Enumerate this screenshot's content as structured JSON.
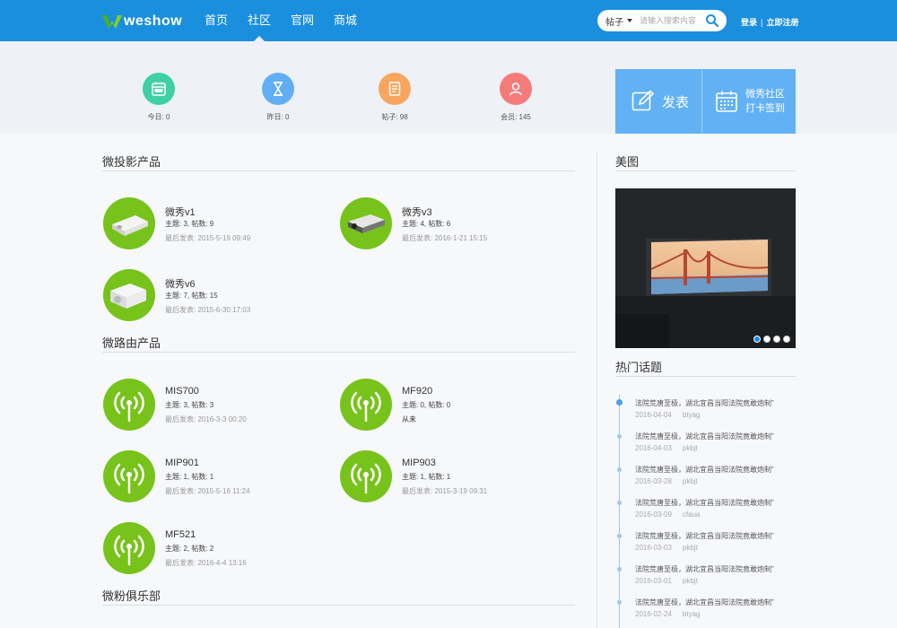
{
  "header": {
    "logo_text": "weshow",
    "nav": [
      "首页",
      "社区",
      "官网",
      "商城"
    ],
    "active_nav": 1,
    "search": {
      "type": "帖子",
      "placeholder": "请输入搜索内容"
    },
    "login": "登录",
    "register": "立即注册",
    "separator": "|"
  },
  "stats": [
    {
      "label": "今日: 0",
      "color": "#3fd0a5",
      "icon": "calendar-new-icon"
    },
    {
      "label": "昨日: 0",
      "color": "#62aef5",
      "icon": "hourglass-icon"
    },
    {
      "label": "帖子: 98",
      "color": "#f7a55f",
      "icon": "document-icon"
    },
    {
      "label": "会员: 145",
      "color": "#f57b7b",
      "icon": "user-icon"
    }
  ],
  "actions": {
    "post": "发表",
    "signin_line1": "微秀社区",
    "signin_line2": "打卡签到"
  },
  "sections": [
    {
      "title": "微投影产品",
      "forums": [
        {
          "name": "微秀v1",
          "count": "主题: 3, 帖数: 9",
          "last": "最后发表: 2015-5-19 09:49",
          "icon": "projector-icon"
        },
        {
          "name": "微秀v3",
          "count": "主题: 4, 帖数: 6",
          "last": "最后发表: 2016-1-21 15:15",
          "icon": "projector-icon"
        },
        {
          "name": "微秀v6",
          "count": "主题: 7, 帖数: 15",
          "last": "最后发表: 2015-6-30 17:03",
          "icon": "projector-icon"
        }
      ]
    },
    {
      "title": "微路由产品",
      "forums": [
        {
          "name": "MIS700",
          "count": "主题: 3, 帖数: 3",
          "last": "最后发表: 2016-3-3 00:20",
          "icon": "antenna-icon"
        },
        {
          "name": "MF920",
          "count": "主题: 0, 帖数: 0",
          "last": "从未",
          "icon": "antenna-icon"
        },
        {
          "name": "MIP901",
          "count": "主题: 1, 帖数: 1",
          "last": "最后发表: 2015-5-16 11:24",
          "icon": "antenna-icon"
        },
        {
          "name": "MIP903",
          "count": "主题: 1, 帖数: 1",
          "last": "最后发表: 2015-3-19 09:31",
          "icon": "antenna-icon"
        },
        {
          "name": "MF521",
          "count": "主题: 2, 帖数: 2",
          "last": "最后发表: 2016-4-4 13:16",
          "icon": "antenna-icon"
        }
      ]
    },
    {
      "title": "微粉俱乐部",
      "forums": []
    }
  ],
  "sidebar": {
    "gallery_title": "美图",
    "carousel_count": 4,
    "carousel_active": 0,
    "hot_title": "热门话题",
    "topics": [
      {
        "title": "法院荒唐至极，湖北宜昌当阳法院竟敢炮制”",
        "date": "2016-04-04",
        "user": "btyag"
      },
      {
        "title": "法院荒唐至极，湖北宜昌当阳法院竟敢炮制”",
        "date": "2016-04-03",
        "user": "pkbjt"
      },
      {
        "title": "法院荒唐至极，湖北宜昌当阳法院竟敢炮制”",
        "date": "2016-03-28",
        "user": "pkbjt"
      },
      {
        "title": "法院荒唐至极，湖北宜昌当阳法院竟敢炮制”",
        "date": "2016-03-09",
        "user": "cfaua"
      },
      {
        "title": "法院荒唐至极，湖北宜昌当阳法院竟敢炮制”",
        "date": "2016-03-03",
        "user": "pkbjt"
      },
      {
        "title": "法院荒唐至极，湖北宜昌当阳法院竟敢炮制”",
        "date": "2016-03-01",
        "user": "pkbjt"
      },
      {
        "title": "法院荒唐至极，湖北宜昌当阳法院竟敢炮制”",
        "date": "2016-02-24",
        "user": "btyag"
      }
    ]
  }
}
